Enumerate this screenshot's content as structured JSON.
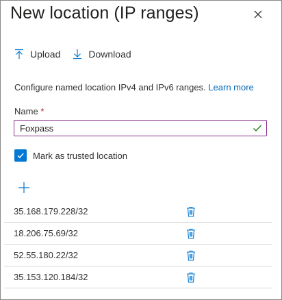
{
  "panel": {
    "title": "New location (IP ranges)",
    "close_icon": "close-icon"
  },
  "toolbar": {
    "upload_label": "Upload",
    "download_label": "Download"
  },
  "description": {
    "text": "Configure named location IPv4 and IPv6 ranges.",
    "link": "Learn more"
  },
  "name_field": {
    "label": "Name",
    "required_marker": "*",
    "value": "Foxpass"
  },
  "trusted": {
    "label": "Mark as trusted location",
    "checked": true
  },
  "ip_ranges": [
    "35.168.179.228/32",
    "18.206.75.69/32",
    "52.55.180.22/32",
    "35.153.120.184/32"
  ],
  "colors": {
    "accent": "#0078d4",
    "link": "#0067b8",
    "input_border": "#8a2f8e",
    "valid_check": "#107c10"
  }
}
